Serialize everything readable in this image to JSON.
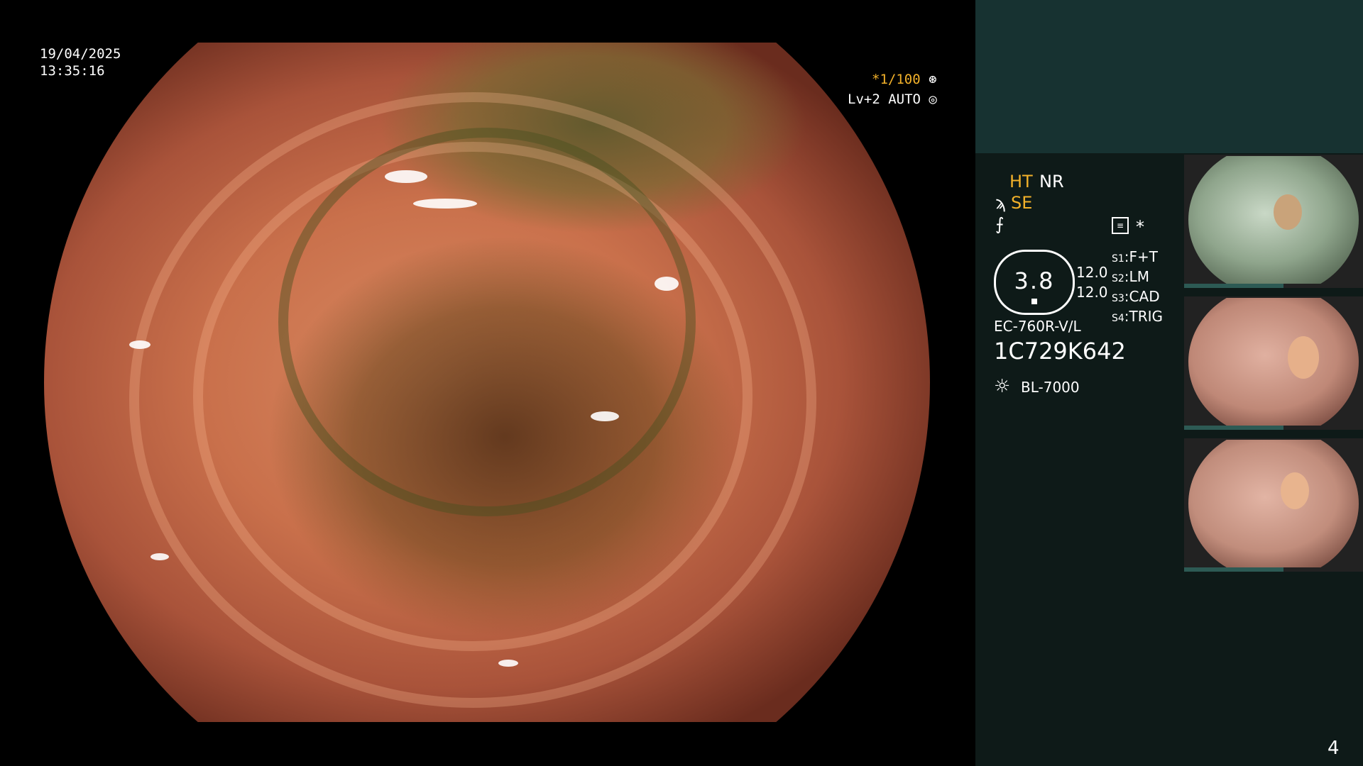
{
  "osd": {
    "date": "19/04/2025",
    "time": "13:35:16",
    "shutter": "*1/100",
    "level": "Lv+2 AUTO"
  },
  "panel": {
    "ht": "HT",
    "nr": "NR",
    "se": "SE",
    "star": "*",
    "gauge_value": "3.8",
    "left_values": [
      "12.0",
      "12.0"
    ],
    "switches": [
      {
        "key": "S1",
        "value": "F+T"
      },
      {
        "key": "S2",
        "value": "LM"
      },
      {
        "key": "S3",
        "value": "CAD"
      },
      {
        "key": "S4",
        "value": "TRIG"
      }
    ],
    "scope_model": "EC-760R-V/L",
    "serial": "1C729K642",
    "light_source": "BL-7000",
    "page_number": "4"
  },
  "colors": {
    "accent_yellow": "#f2b12a",
    "panel_bg": "#0e1a18",
    "panel_top": "#173231"
  },
  "icons": [
    "aperture-icon",
    "auto-iris-icon",
    "brightness-icon",
    "lamp-icon",
    "menu-icon"
  ]
}
